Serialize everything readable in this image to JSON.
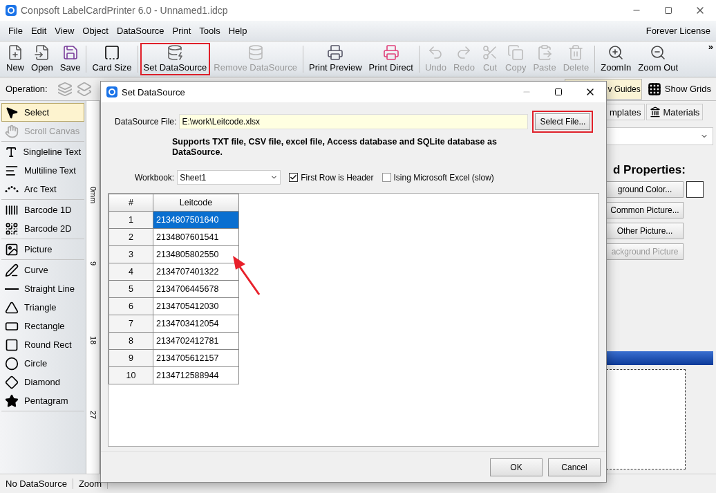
{
  "window": {
    "title": "Conpsoft LabelCardPrinter 6.0 - Unnamed1.idcp"
  },
  "menu": [
    "File",
    "Edit",
    "View",
    "Object",
    "DataSource",
    "Print",
    "Tools",
    "Help"
  ],
  "license": "Forever License",
  "toolbar": [
    {
      "label": "New",
      "disabled": false,
      "highlighted": false
    },
    {
      "label": "Open",
      "disabled": false,
      "highlighted": false
    },
    {
      "label": "Save",
      "disabled": false,
      "highlighted": false
    },
    {
      "label": "Card Size",
      "disabled": false,
      "highlighted": false
    },
    {
      "label": "Set DataSource",
      "disabled": false,
      "highlighted": true
    },
    {
      "label": "Remove DataSource",
      "disabled": true,
      "highlighted": false
    },
    {
      "label": "Print Preview",
      "disabled": false,
      "highlighted": false
    },
    {
      "label": "Print Direct",
      "disabled": false,
      "highlighted": false
    },
    {
      "label": "Undo",
      "disabled": true,
      "highlighted": false
    },
    {
      "label": "Redo",
      "disabled": true,
      "highlighted": false
    },
    {
      "label": "Cut",
      "disabled": true,
      "highlighted": false
    },
    {
      "label": "Copy",
      "disabled": true,
      "highlighted": false
    },
    {
      "label": "Paste",
      "disabled": true,
      "highlighted": false
    },
    {
      "label": "Delete",
      "disabled": true,
      "highlighted": false
    },
    {
      "label": "ZoomIn",
      "disabled": false,
      "highlighted": false
    },
    {
      "label": "Zoom Out",
      "disabled": false,
      "highlighted": false
    }
  ],
  "overflow": "»",
  "operation": {
    "label": "Operation:",
    "guides": {
      "label": "v Guides",
      "on": true
    },
    "grids": {
      "label": "Show Grids",
      "on": false
    }
  },
  "tools": [
    [
      {
        "label": "Select",
        "selected": true,
        "disabled": false
      },
      {
        "label": "Scroll Canvas",
        "selected": false,
        "disabled": true
      }
    ],
    [
      {
        "label": "Singleline Text",
        "selected": false,
        "disabled": false
      },
      {
        "label": "Multiline Text",
        "selected": false,
        "disabled": false
      },
      {
        "label": "Arc Text",
        "selected": false,
        "disabled": false
      }
    ],
    [
      {
        "label": "Barcode 1D",
        "selected": false,
        "disabled": false
      },
      {
        "label": "Barcode 2D",
        "selected": false,
        "disabled": false
      }
    ],
    [
      {
        "label": "Picture",
        "selected": false,
        "disabled": false
      }
    ],
    [
      {
        "label": "Curve",
        "selected": false,
        "disabled": false
      },
      {
        "label": "Straight Line",
        "selected": false,
        "disabled": false
      },
      {
        "label": "Triangle",
        "selected": false,
        "disabled": false
      },
      {
        "label": "Rectangle",
        "selected": false,
        "disabled": false
      },
      {
        "label": "Round Rect",
        "selected": false,
        "disabled": false
      },
      {
        "label": "Circle",
        "selected": false,
        "disabled": false
      },
      {
        "label": "Diamond",
        "selected": false,
        "disabled": false
      },
      {
        "label": "Pentagram",
        "selected": false,
        "disabled": false
      }
    ]
  ],
  "ruler": [
    "0mm",
    "9",
    "18",
    "27"
  ],
  "right_panel": {
    "tabs": [
      {
        "label": "mplates",
        "selected": false
      },
      {
        "label": "Materials",
        "selected": false
      }
    ],
    "heading": "d Properties:",
    "buttons": [
      {
        "label": "ground Color...",
        "disabled": false
      },
      {
        "label": "Common Picture...",
        "disabled": false
      },
      {
        "label": "Other Picture...",
        "disabled": false
      },
      {
        "label": "ackground Picture",
        "disabled": true
      }
    ]
  },
  "status_bar": [
    "No DataSource",
    "Zoom"
  ],
  "dialog": {
    "title": "Set DataSource",
    "file_label": "DataSource File:",
    "file_value": "E:\\work\\Leitcode.xlsx",
    "select_file": {
      "label": "Select File...",
      "highlighted": true
    },
    "note": "Supports TXT file, CSV file, excel file, Access database and SQLite database as DataSource.",
    "workbook_label": "Workbook:",
    "workbook_value": "Sheet1",
    "options": [
      {
        "label": "First Row is Header",
        "checked": true
      },
      {
        "label": "Ising Microsoft Excel (slow)",
        "checked": false
      }
    ],
    "table": {
      "columns": [
        "#",
        "Leitcode"
      ],
      "rows": [
        {
          "cells": [
            "1",
            "2134807501640"
          ],
          "selected": true
        },
        {
          "cells": [
            "2",
            "2134807601541"
          ],
          "selected": false
        },
        {
          "cells": [
            "3",
            "2134805802550"
          ],
          "selected": false
        },
        {
          "cells": [
            "4",
            "2134707401322"
          ],
          "selected": false
        },
        {
          "cells": [
            "5",
            "2134706445678"
          ],
          "selected": false
        },
        {
          "cells": [
            "6",
            "2134705412030"
          ],
          "selected": false
        },
        {
          "cells": [
            "7",
            "2134703412054"
          ],
          "selected": false
        },
        {
          "cells": [
            "8",
            "2134702412781"
          ],
          "selected": false
        },
        {
          "cells": [
            "9",
            "2134705612157"
          ],
          "selected": false
        },
        {
          "cells": [
            "10",
            "2134712588944"
          ],
          "selected": false
        }
      ]
    },
    "buttons": [
      "OK",
      "Cancel"
    ]
  }
}
